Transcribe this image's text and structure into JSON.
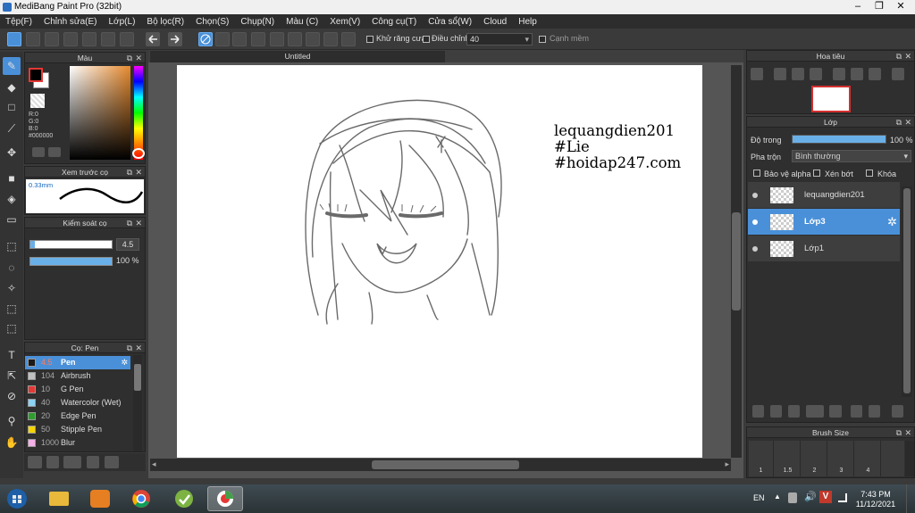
{
  "window": {
    "title": "MediBang Paint Pro (32bit)"
  },
  "menu": [
    "Tệp(F)",
    "Chỉnh sửa(E)",
    "Lớp(L)",
    "Bộ lọc(R)",
    "Chọn(S)",
    "Chụp(N)",
    "Màu (C)",
    "Xem(V)",
    "Công cụ(T)",
    "Cửa sổ(W)",
    "Cloud",
    "Help"
  ],
  "toolbar": {
    "antialias_label": "Khử răng cưa",
    "adjust_label": "Điều chỉnh",
    "adjust_value": "40",
    "edge_label": "Cạnh mềm"
  },
  "color_panel": {
    "title": "Màu",
    "r": "R:0",
    "g": "G:0",
    "b": "B:0",
    "hex": "#000000",
    "fg_color": "#000000",
    "bg_color": "#ffffff"
  },
  "brush_preview": {
    "title": "Xem trước cọ",
    "size": "0.33mm"
  },
  "brush_control": {
    "title": "Kiểm soát cọ",
    "size_value": "4.5",
    "opacity_value": "100 %",
    "size_fraction": 0.05,
    "opacity_fraction": 1.0
  },
  "brush_list": {
    "title": "Cọ: Pen",
    "items": [
      {
        "size": "4.5",
        "name": "Pen",
        "color": "#1a1a1a"
      },
      {
        "size": "104",
        "name": "Airbrush",
        "color": "#bfbfbf"
      },
      {
        "size": "10",
        "name": "G Pen",
        "color": "#e53935"
      },
      {
        "size": "40",
        "name": "Watercolor (Wet)",
        "color": "#8ad3f5"
      },
      {
        "size": "20",
        "name": "Edge Pen",
        "color": "#2e9c2e"
      },
      {
        "size": "50",
        "name": "Stipple Pen",
        "color": "#f5d400"
      },
      {
        "size": "1000",
        "name": "Blur",
        "color": "#f5b0e8"
      }
    ]
  },
  "canvas": {
    "tab_title": "Untitled",
    "text_lines": [
      "lequangdien201",
      "#Lie",
      "#hoidap247.com"
    ]
  },
  "navigator": {
    "title": "Hoa tiêu"
  },
  "layer_panel": {
    "title": "Lớp",
    "opacity_label": "Độ trong",
    "opacity_value": "100 %",
    "opacity_fraction": 1.0,
    "blend_label": "Pha trộn",
    "blend_value": "Bình thường",
    "protect_alpha": "Bảo vệ alpha",
    "clipping": "Xén bớt",
    "lock": "Khóa",
    "layers": [
      {
        "name": "lequangdien201",
        "selected": false
      },
      {
        "name": "Lớp3",
        "selected": true
      },
      {
        "name": "Lớp1",
        "selected": false
      }
    ]
  },
  "brush_size_panel": {
    "title": "Brush Size",
    "sizes": [
      "1",
      "1.5",
      "2",
      "3",
      "4"
    ]
  },
  "taskbar": {
    "lang": "EN",
    "time": "7:43 PM",
    "date": "11/12/2021"
  }
}
